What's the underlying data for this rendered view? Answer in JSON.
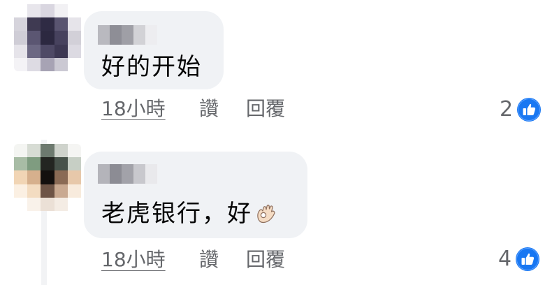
{
  "colors": {
    "bubble": "#f0f2f5",
    "meta_text": "#65676b",
    "body_text": "#050505",
    "like_blue": "#1877f2"
  },
  "comments": [
    {
      "author_name": "",
      "text": "好的开始",
      "time": "18小時",
      "like_action": "讚",
      "reply_action": "回覆",
      "like_count": "2",
      "emoji_icon": "",
      "avatar_colors": [
        "#ffffff",
        "#e8e6ec",
        "#d9d6e0",
        "#f2f1f4",
        "#ffffff",
        "#d6d4dc",
        "#3f3a52",
        "#2f2b44",
        "#595470",
        "#e6e4ea",
        "#cfcdd6",
        "#5b5672",
        "#2c2840",
        "#47425e",
        "#d2d0d8",
        "#e6e4ea",
        "#6c6883",
        "#4e4965",
        "#3d3853",
        "#dcdae2",
        "#f4f3f6",
        "#dddbe3",
        "#a7a3b4",
        "#cbc9d3",
        "#ffffff"
      ],
      "name_blur_colors": [
        "#b9b9bf",
        "#8e8e96",
        "#9f9fa6",
        "#d2d2d6",
        "#ededf0"
      ]
    },
    {
      "author_name": "",
      "text": "老虎银行，好",
      "time": "18小時",
      "like_action": "讚",
      "reply_action": "回覆",
      "like_count": "4",
      "emoji_icon": "ok-hand-icon",
      "avatar_colors": [
        "#f4f5f2",
        "#d7dcd4",
        "#6d7a6f",
        "#cfd3cc",
        "#f5f5f3",
        "#a8bca5",
        "#7f9c80",
        "#232521",
        "#47524a",
        "#c7cfc5",
        "#f1d5b5",
        "#d6b08d",
        "#130f0e",
        "#8a6a55",
        "#e7c8aa",
        "#fbf0e3",
        "#f3dcc1",
        "#6e5446",
        "#c9a991",
        "#f8ebdd",
        "#ffffff",
        "#f9f2ea",
        "#ebe0d6",
        "#f4ece4",
        "#ffffff"
      ],
      "name_blur_colors": [
        "#b4b4ba",
        "#8c8c94",
        "#a2a2a9",
        "#c8c8cd",
        "#e9e9ec"
      ]
    }
  ]
}
